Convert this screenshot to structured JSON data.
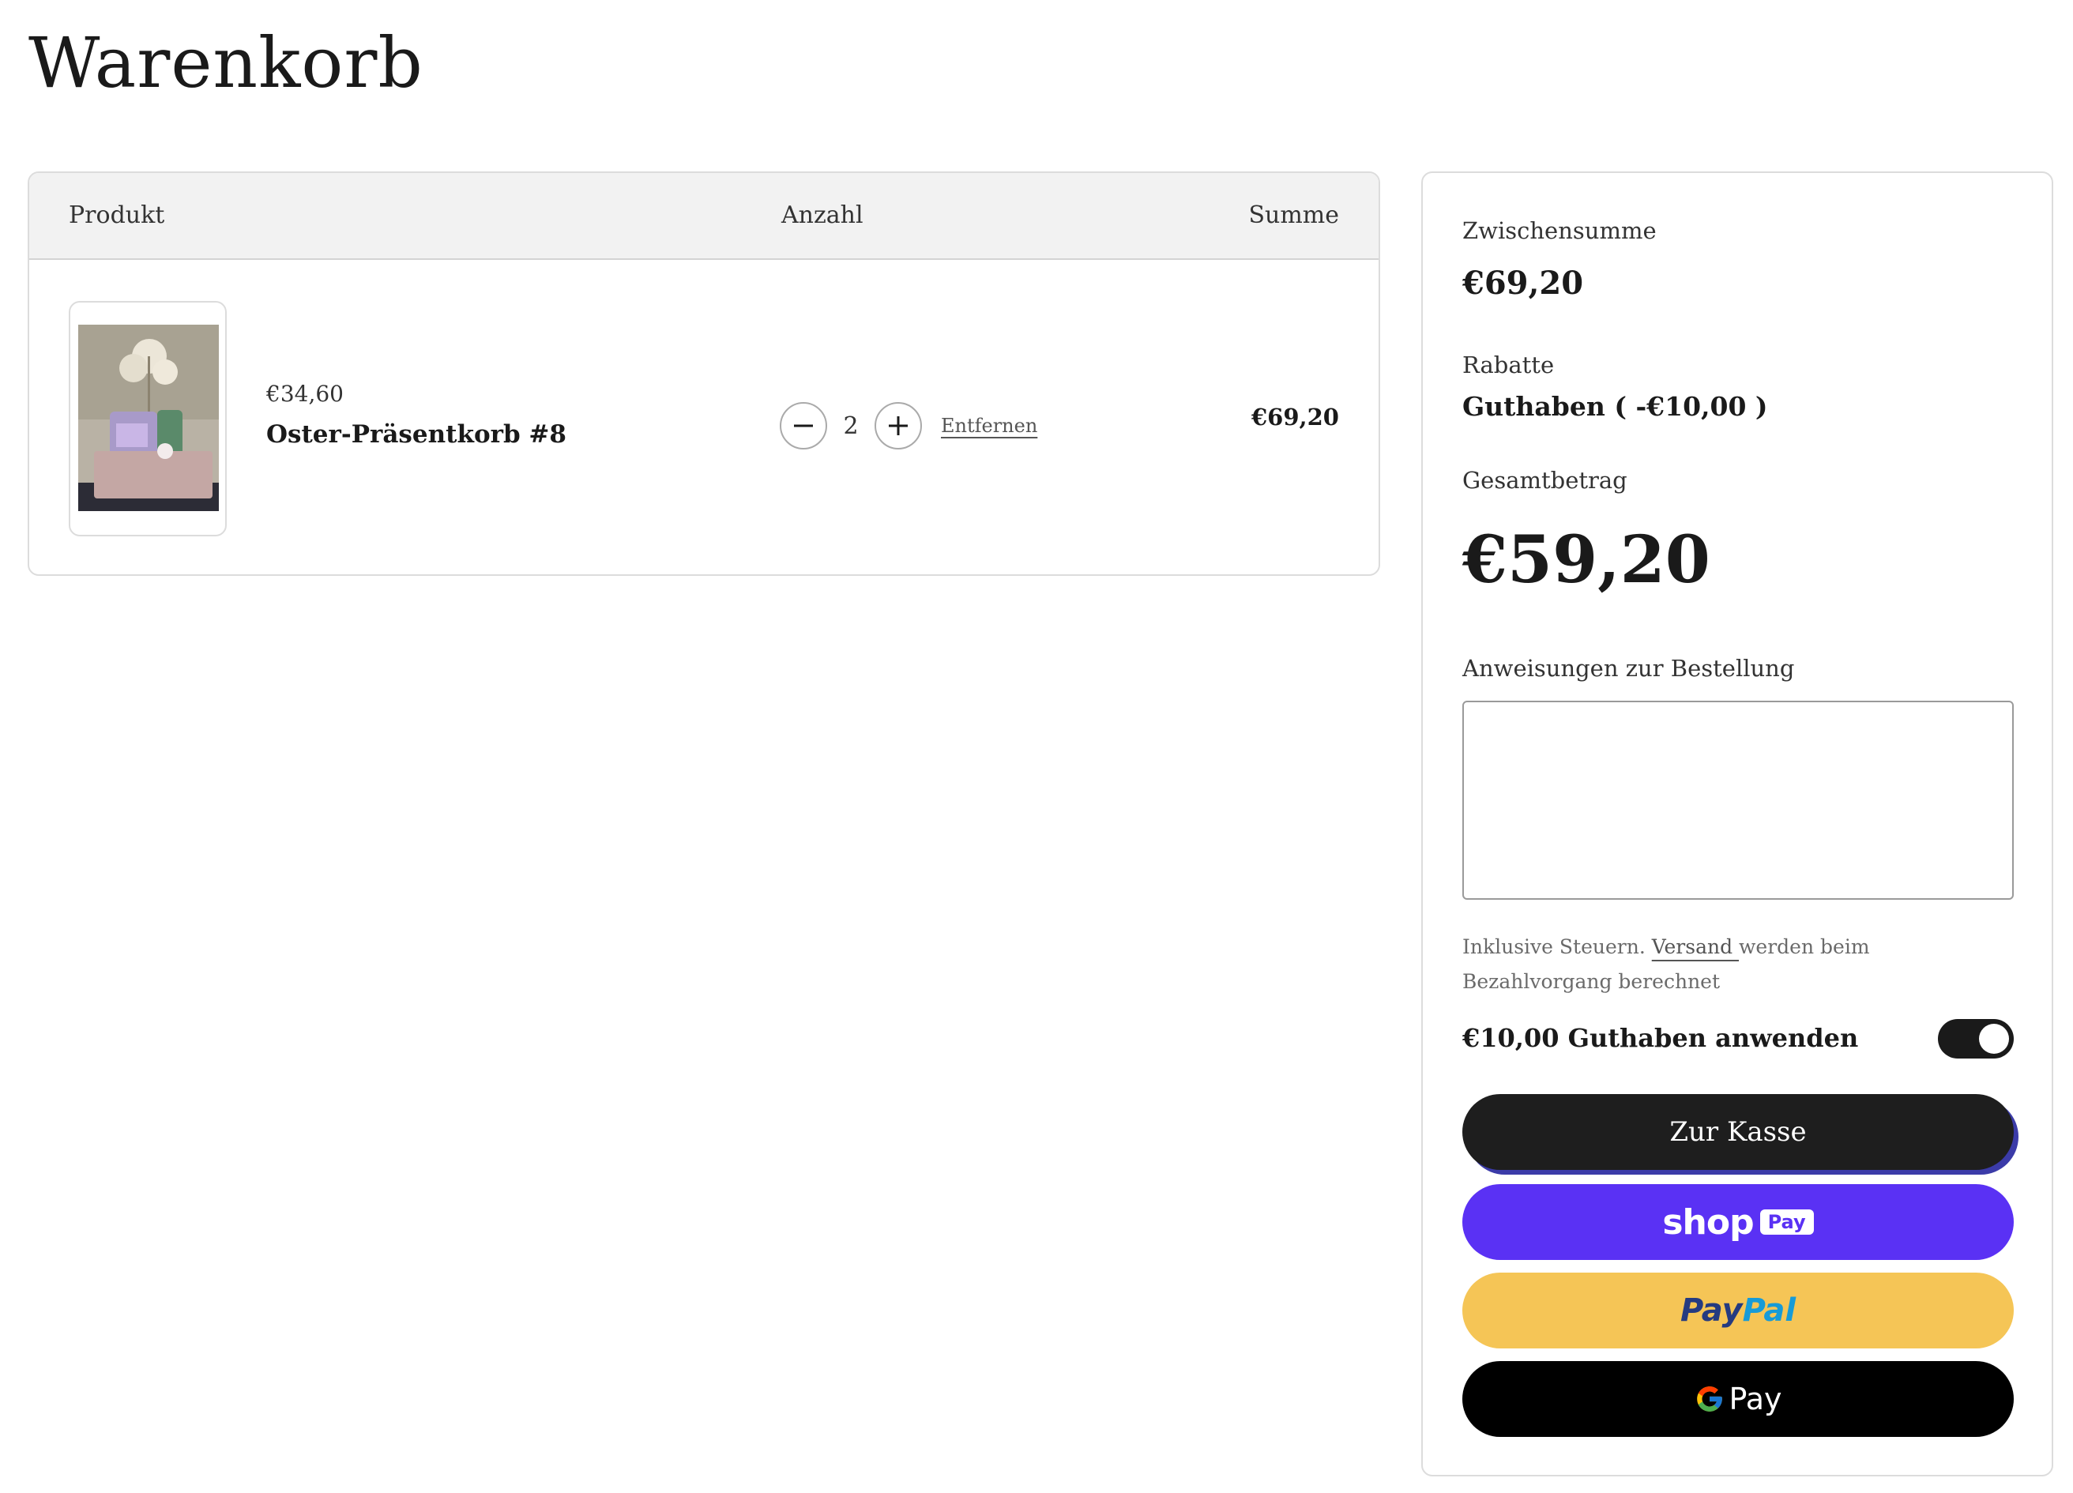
{
  "page": {
    "title": "Warenkorb"
  },
  "cart": {
    "headers": {
      "product": "Produkt",
      "quantity": "Anzahl",
      "total": "Summe"
    },
    "items": [
      {
        "unit_price": "€34,60",
        "name": "Oster-Präsentkorb #8",
        "quantity": "2",
        "remove_label": "Entfernen",
        "line_total": "€69,20"
      }
    ]
  },
  "summary": {
    "subtotal_label": "Zwischensumme",
    "subtotal_value": "€69,20",
    "discounts_label": "Rabatte",
    "discounts_value": "Guthaben ( -€10,00 )",
    "total_label": "Gesamtbetrag",
    "total_value": "€59,20",
    "notes_label": "Anweisungen zur Bestellung",
    "notes_value": "",
    "tax_note_before": "Inklusive Steuern. ",
    "tax_note_link": "Versand ",
    "tax_note_after": "werden beim Bezahlvorgang berechnet",
    "credit_toggle_label": "€10,00 Guthaben anwenden",
    "credit_toggle_on": true,
    "checkout_label": "Zur Kasse",
    "shop_pay_word": "shop",
    "shop_pay_badge": "Pay",
    "paypal_pay": "Pay",
    "paypal_pal": "Pal",
    "gpay_word": "Pay"
  },
  "colors": {
    "shop_pay": "#5a31f4",
    "paypal": "#f5c556",
    "gpay": "#000000",
    "checkout": "#1e1e1e"
  }
}
